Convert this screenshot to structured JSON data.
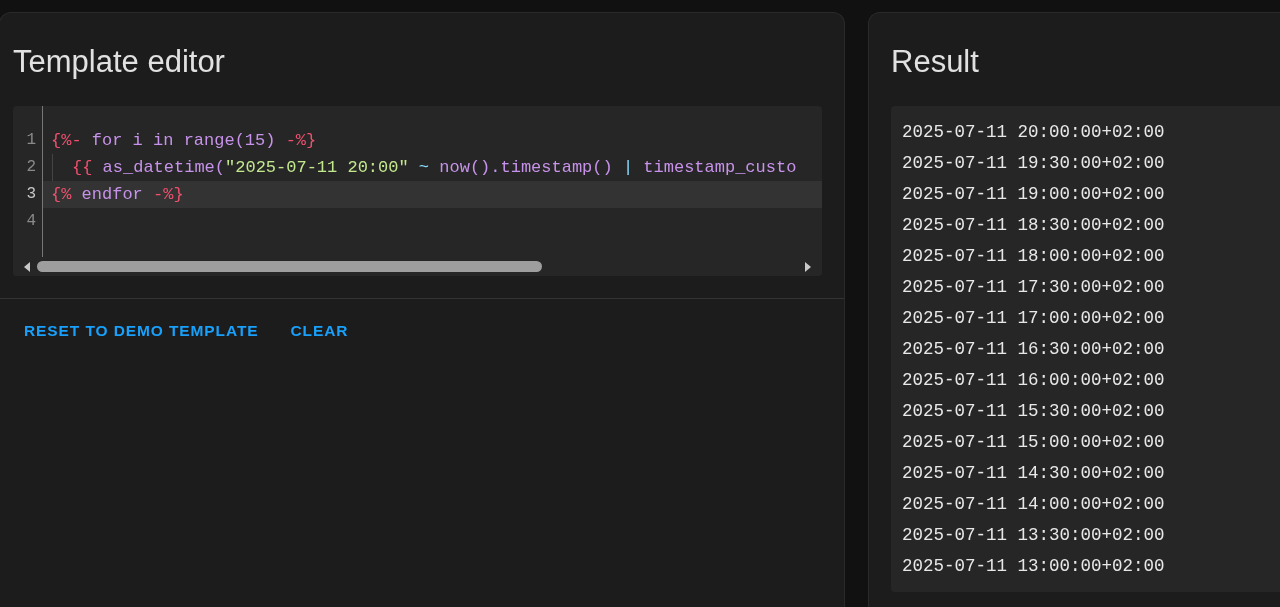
{
  "editor_card": {
    "title": "Template editor",
    "code_lines": [
      {
        "number": "1",
        "active": false,
        "tokens": [
          {
            "kind": "delim",
            "text": "{%-"
          },
          {
            "kind": "keyword",
            "text": " for i in range(15) "
          },
          {
            "kind": "delim",
            "text": "-%}"
          }
        ]
      },
      {
        "number": "2",
        "active": false,
        "indent": true,
        "tokens": [
          {
            "kind": "delim",
            "text": "{{"
          },
          {
            "kind": "keyword",
            "text": " as_datetime("
          },
          {
            "kind": "string",
            "text": "\"2025-07-11 20:00\""
          },
          {
            "kind": "op",
            "text": " ~ "
          },
          {
            "kind": "keyword",
            "text": "now().timestamp() "
          },
          {
            "kind": "op",
            "text": "|"
          },
          {
            "kind": "keyword",
            "text": " timestamp_custo"
          }
        ]
      },
      {
        "number": "3",
        "active": true,
        "tokens": [
          {
            "kind": "delim",
            "text": "{%"
          },
          {
            "kind": "keyword",
            "text": " endfor "
          },
          {
            "kind": "delim",
            "text": "-%}"
          }
        ]
      },
      {
        "number": "4",
        "active": false
      }
    ],
    "buttons": [
      "RESET TO DEMO TEMPLATE",
      "CLEAR"
    ]
  },
  "result_card": {
    "title": "Result",
    "lines": [
      "2025-07-11 20:00:00+02:00",
      "2025-07-11 19:30:00+02:00",
      "2025-07-11 19:00:00+02:00",
      "2025-07-11 18:30:00+02:00",
      "2025-07-11 18:00:00+02:00",
      "2025-07-11 17:30:00+02:00",
      "2025-07-11 17:00:00+02:00",
      "2025-07-11 16:30:00+02:00",
      "2025-07-11 16:00:00+02:00",
      "2025-07-11 15:30:00+02:00",
      "2025-07-11 15:00:00+02:00",
      "2025-07-11 14:30:00+02:00",
      "2025-07-11 14:00:00+02:00",
      "2025-07-11 13:30:00+02:00",
      "2025-07-11 13:00:00+02:00"
    ]
  }
}
